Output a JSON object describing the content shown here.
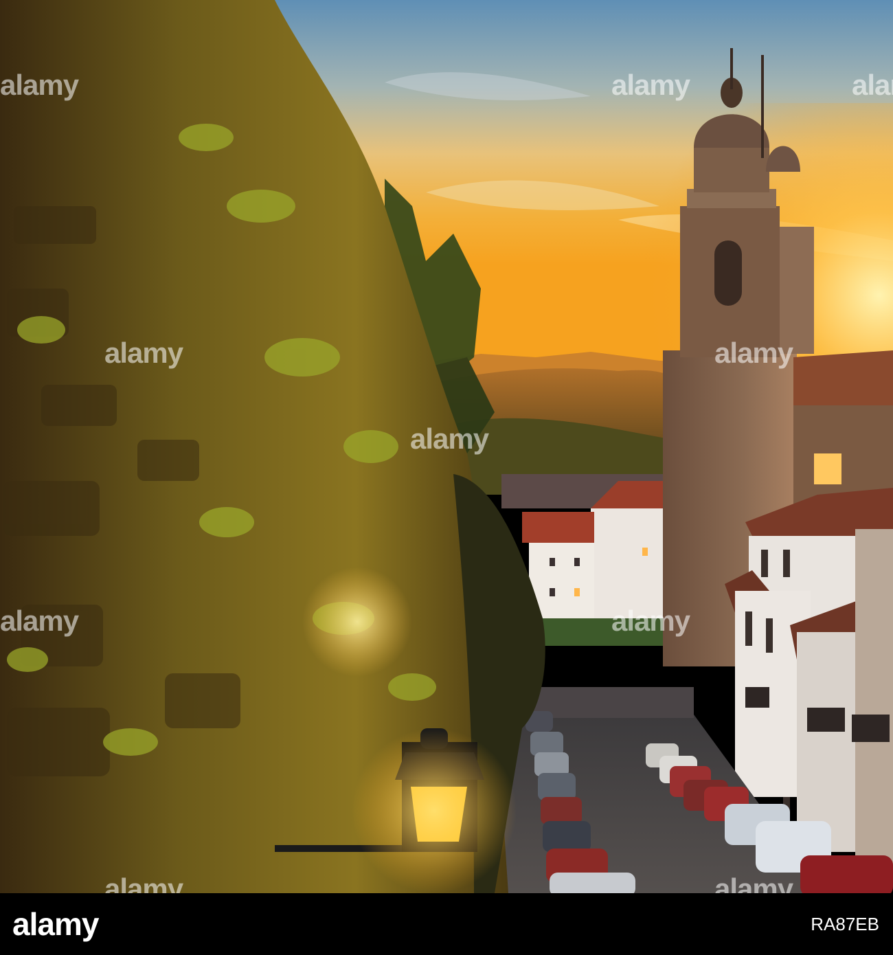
{
  "watermark": {
    "text": "alamy"
  },
  "footer": {
    "logo_text": "alamy",
    "image_id": "RA87EB"
  },
  "colors": {
    "sky_gold": "#f3b03a",
    "sky_blue": "#5f8fb5",
    "stone_tower": "#8a6a52",
    "wall_moss": "#6b5a1a",
    "lamp_glow": "#ffd23a"
  }
}
